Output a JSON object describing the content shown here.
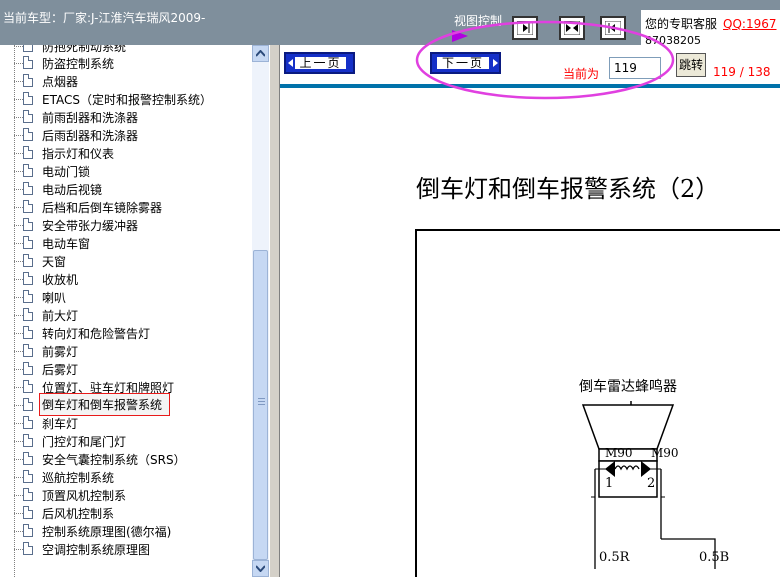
{
  "header": {
    "model_label": "当前车型：厂家:J-江淮汽车瑞风2009-",
    "view_control_label": "视图控制",
    "service_text": "您的专职客服",
    "qq_link": "QQ:1967",
    "phone": "87038205"
  },
  "tree": {
    "items": [
      {
        "label": "防盗控制系统"
      },
      {
        "label": "点烟器"
      },
      {
        "label": "ETACS（定时和报警控制系统）"
      },
      {
        "label": "前雨刮器和洗涤器"
      },
      {
        "label": "后雨刮器和洗涤器"
      },
      {
        "label": "指示灯和仪表"
      },
      {
        "label": "电动门锁"
      },
      {
        "label": "电动后视镜"
      },
      {
        "label": "后档和后倒车镜除雾器"
      },
      {
        "label": "安全带张力缓冲器"
      },
      {
        "label": "电动车窗"
      },
      {
        "label": "天窗"
      },
      {
        "label": "收放机"
      },
      {
        "label": "喇叭"
      },
      {
        "label": "前大灯"
      },
      {
        "label": "转向灯和危险警告灯"
      },
      {
        "label": "前雾灯"
      },
      {
        "label": "后雾灯"
      },
      {
        "label": "位置灯、驻车灯和牌照灯"
      },
      {
        "label": "倒车灯和倒车报警系统"
      },
      {
        "label": "刹车灯"
      },
      {
        "label": "门控灯和尾门灯"
      },
      {
        "label": "安全气囊控制系统（SRS）"
      },
      {
        "label": "巡航控制系统"
      },
      {
        "label": "顶置风机控制系"
      },
      {
        "label": "后风机控制系"
      },
      {
        "label": "控制系统原理图(德尔福)"
      },
      {
        "label": "空调控制系统原理图"
      }
    ],
    "selected": "倒车灯和倒车报警系统"
  },
  "nav": {
    "prev_label": "上一页",
    "next_label": "下一页",
    "current_label": "当前为",
    "page_value": "119",
    "jump_label": "跳转",
    "page_count": "119 / 138"
  },
  "document": {
    "title": "倒车灯和倒车报警系统（2）",
    "component_label": "倒车雷达蜂鸣器",
    "connector_left": "M90",
    "connector_right": "M90",
    "pin_left": "1",
    "pin_right": "2",
    "wire_left": "0.5R",
    "wire_right": "0.5B"
  },
  "colors": {
    "header_bg": "#7f8f9c",
    "nav_strip": "#0072aa",
    "button_blue": "#1530c8",
    "highlight_ellipse": "#e040e0",
    "accent_red": "#ff0000"
  }
}
